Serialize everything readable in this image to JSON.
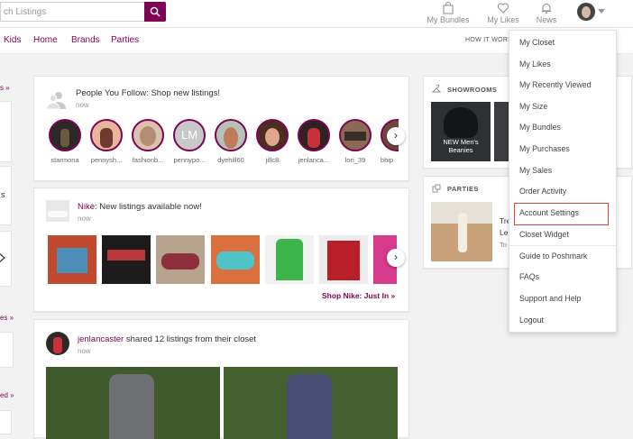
{
  "header": {
    "search_placeholder": "ch Listings",
    "nav": [
      {
        "label": "My Bundles",
        "icon": "shopping-bag-icon"
      },
      {
        "label": "My Likes",
        "icon": "heart-icon"
      },
      {
        "label": "News",
        "icon": "bell-icon"
      }
    ],
    "accent": "#7f0353"
  },
  "nav_bar": {
    "links": [
      "Kids",
      "Home",
      "Brands",
      "Parties"
    ],
    "how_it_works": "HOW IT WORI"
  },
  "left_strip": {
    "links": [
      "s »",
      "es »",
      "ed »"
    ],
    "text": [
      "s"
    ]
  },
  "follow_card": {
    "title": "People You Follow: Shop new listings!",
    "time": "now",
    "users": [
      "starmona",
      "pennysh...",
      "fashionb...",
      "pennypo...",
      "dyehill60",
      "jillc8",
      "jenlanca...",
      "lori_39",
      "bhip"
    ],
    "initials": "LM"
  },
  "brand_card": {
    "brand": "Nike",
    "title_rest": ": New listings available now!",
    "time": "now",
    "shop_link": "Shop Nike: Just In »"
  },
  "share_card": {
    "user": "jenlancaster",
    "text": " shared 12 listings from their closet",
    "time": "now"
  },
  "showrooms": {
    "heading": "SHOWROOMS",
    "tile_label": "NEW Men's Beanies"
  },
  "parties": {
    "heading": "PARTIES",
    "lines": [
      "Tre",
      "Le",
      "To"
    ]
  },
  "menu": {
    "items": [
      "My Closet",
      "My Likes",
      "My Recently Viewed",
      "My Size",
      "My Bundles",
      "My Purchases",
      "My Sales",
      "Order Activity",
      "Account Settings",
      "Closet Widget",
      "Guide to Poshmark",
      "FAQs",
      "Support and Help",
      "Logout"
    ],
    "highlighted": "Account Settings",
    "highlight_color": "#e0483a"
  }
}
